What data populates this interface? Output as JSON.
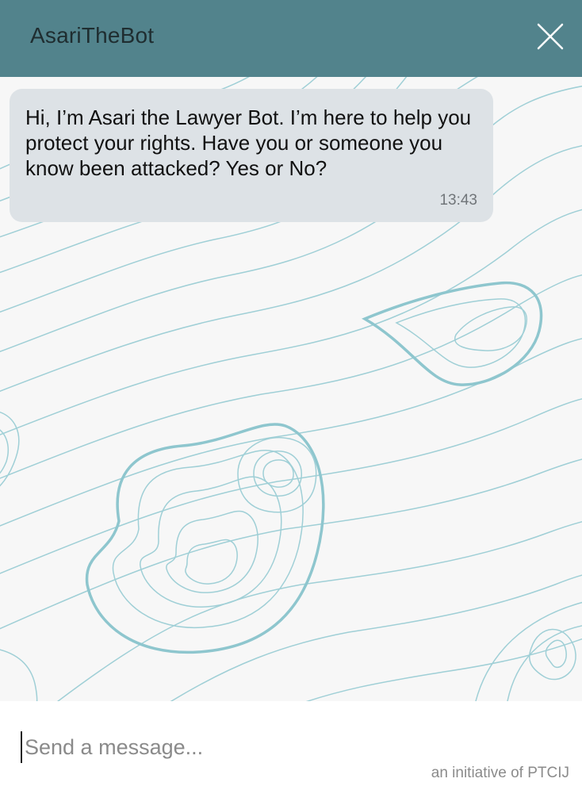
{
  "header": {
    "title": "AsariTheBot",
    "close_icon": "close-icon"
  },
  "messages": [
    {
      "sender": "bot",
      "text": "Hi, I’m Asari the Lawyer Bot. I’m here to help you protect your rights. Have you or someone you know been attacked? Yes or No?",
      "time": "13:43"
    }
  ],
  "composer": {
    "placeholder": "Send a message...",
    "value": ""
  },
  "footer": {
    "credit": "an initiative of PTCIJ"
  },
  "colors": {
    "header_bg": "#52838c",
    "bubble_bg": "#dde2e6",
    "topo_line": "#9fcfd6",
    "background": "#f7f7f7"
  }
}
